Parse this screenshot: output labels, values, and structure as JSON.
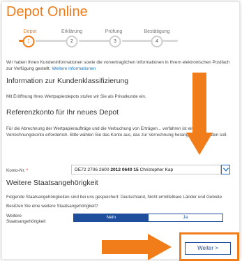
{
  "header": {
    "title": "Depot Online"
  },
  "steps": [
    {
      "label": "Depot",
      "number": "1",
      "active": true
    },
    {
      "label": "Erklärung",
      "number": "2",
      "active": false
    },
    {
      "label": "Prüfung",
      "number": "3",
      "active": false
    },
    {
      "label": "Bestätigung",
      "number": "4",
      "active": false
    }
  ],
  "intro": {
    "text": "Wir haben Ihnen Kundeninformationen sowie die vorvertraglichen Informationen in Ihrem elektronischen Postfach zur Verfügung gestellt.",
    "link": "Weitere Informationen"
  },
  "section_kunden": {
    "heading": "Information zur Kundenklassifizierung",
    "text": "Mit Eröffnung Ihres Wertpapierdepots stufen wir Sie als Privatkunde ein."
  },
  "section_referenz": {
    "heading": "Referenzkonto für Ihr neues Depot",
    "text": "Für die Abrechnung der Wertpapieraufträge und die Verbuchung von Erträgen... verfahren ist ein Verrechnungskonto erforderlich. Bitte wählen Sie das Konto aus, das zur Verrechnung herangezogen werden soll.",
    "konto_label": "Konto-Nr.",
    "konto_required": "*",
    "konto_prefix": "DE72 2706 2600",
    "konto_bold": "2012 0640 15",
    "konto_name": "Christopher Kap"
  },
  "section_staat": {
    "heading": "Weitere Staatsangehörigkeit",
    "text": "Folgende Staatsangehörigkeiten sind bei uns gespeichert: Deutschland, Nicht ermittelbare Länder und Gebiete",
    "question": "Besitzen Sie eine weitere Staatsangehörigkeit?",
    "field_label_1": "Weitere",
    "field_label_2": "Staatsangehörigkeit",
    "option_no": "Nein",
    "option_yes": "Ja"
  },
  "footer": {
    "next_button": "Weiter >"
  },
  "colors": {
    "accent": "#f07c1a",
    "primary": "#1f4f9c",
    "link": "#1a73c7"
  }
}
